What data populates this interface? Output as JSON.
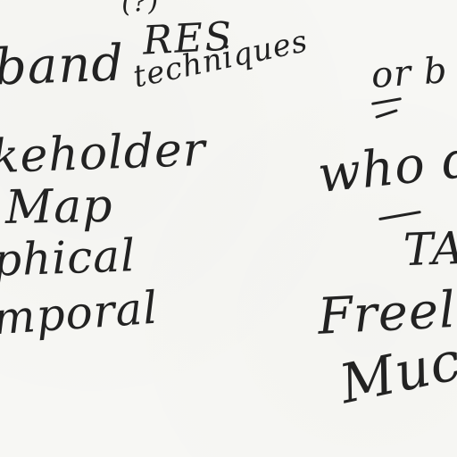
{
  "notes": {
    "top_fragment": "(?)",
    "res_title": "RES",
    "res_sub": "techniques",
    "left_lines": [
      "band",
      "keholder",
      "Map",
      "phical",
      "mporal"
    ],
    "right_lines": [
      "or b",
      "who d",
      "TA",
      "Freelan",
      "Muc"
    ]
  }
}
